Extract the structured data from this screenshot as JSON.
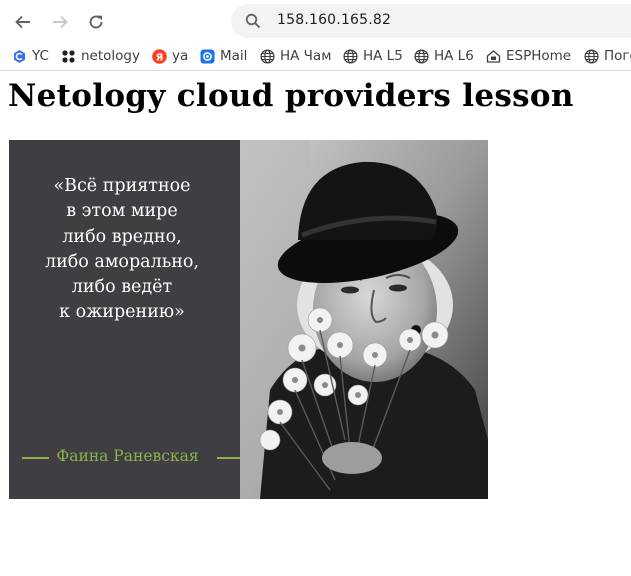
{
  "browser": {
    "url": "158.160.165.82",
    "bookmarks": [
      {
        "label": "YC",
        "icon": "yc-icon",
        "color": "#3e6df5"
      },
      {
        "label": "netology",
        "icon": "netology-icon",
        "color": "#222222"
      },
      {
        "label": "ya",
        "icon": "yandex-icon",
        "color": "#fc3f1d"
      },
      {
        "label": "Mail",
        "icon": "mail-icon",
        "color": "#1a73e8"
      },
      {
        "label": "HA Чам",
        "icon": "globe-icon"
      },
      {
        "label": "HA L5",
        "icon": "globe-icon"
      },
      {
        "label": "HA L6",
        "icon": "globe-icon"
      },
      {
        "label": "ESPHome",
        "icon": "esphome-icon"
      },
      {
        "label": "Пого",
        "icon": "globe-icon"
      }
    ]
  },
  "page": {
    "title": "Netology cloud providers lesson",
    "image": {
      "quote_lines": [
        "«Всё приятное",
        "в этом мире",
        "либо вредно,",
        "либо аморально,",
        "либо ведёт",
        "к ожирению»"
      ],
      "author": "Фаина Раневская",
      "colors": {
        "panel": "#3f3e43",
        "author": "#8cb04a"
      }
    }
  }
}
